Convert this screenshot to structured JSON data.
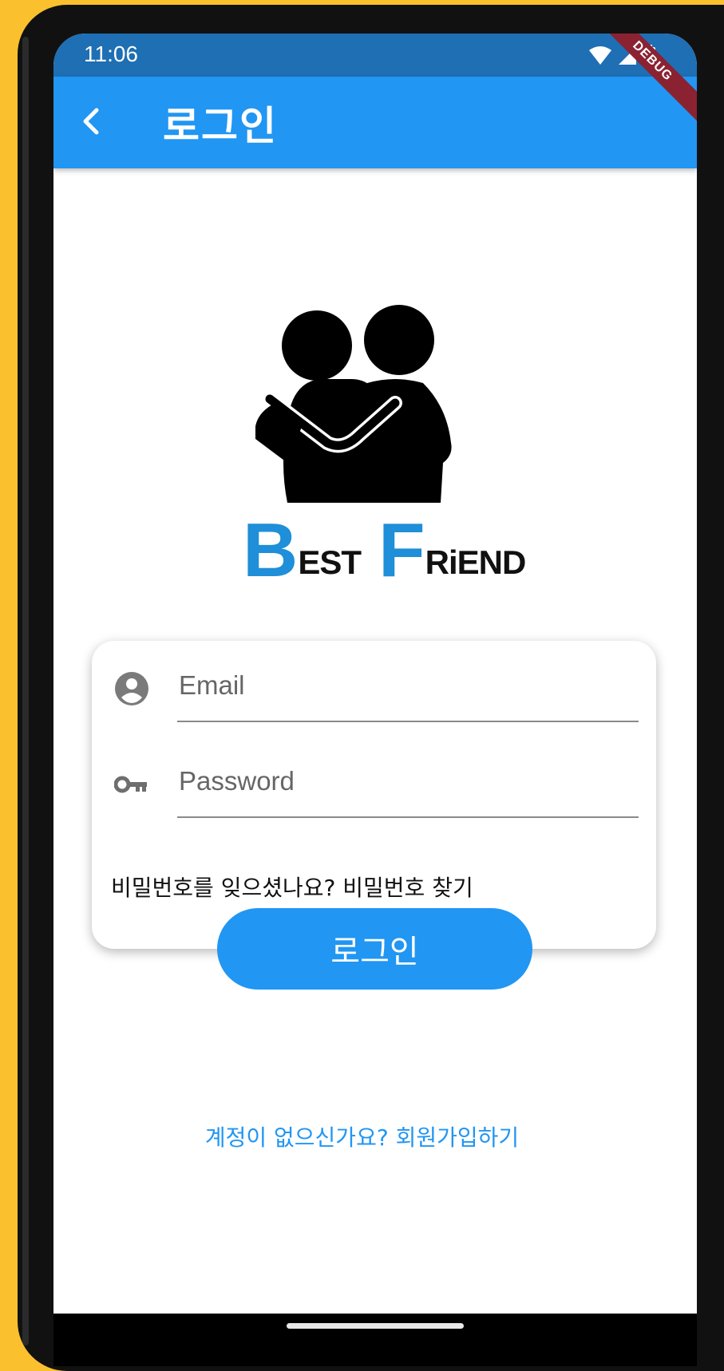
{
  "status_bar": {
    "time": "11:06"
  },
  "app_bar": {
    "title": "로그인",
    "debug_label": "DEBUG"
  },
  "logo": {
    "first_initial": "B",
    "first_rest": "EST",
    "second_initial": "F",
    "second_rest": "RiEND"
  },
  "form": {
    "email_placeholder": "Email",
    "password_placeholder": "Password",
    "forgot_text": "비밀번호를 잊으셨나요? 비밀번호 찾기"
  },
  "login_button": "로그인",
  "signup_text": "계정이 없으신가요? 회원가입하기",
  "colors": {
    "primary": "#2196F3",
    "status_bar": "#1E6FB3",
    "background_frame": "#FBC02D",
    "logo_blue": "#1E8FD8"
  },
  "icons": [
    "back-arrow-icon",
    "wifi-icon",
    "signal-icon",
    "battery-icon",
    "account-circle-icon",
    "key-icon"
  ]
}
